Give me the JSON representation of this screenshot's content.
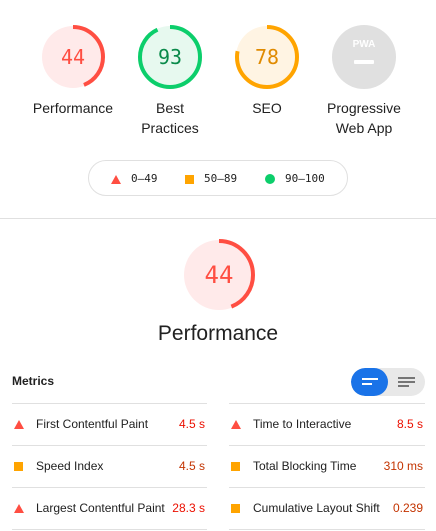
{
  "colors": {
    "fail": "#ff4e42",
    "average": "#ffa400",
    "pass": "#0cce6b",
    "fail_bg": "#ffeaea",
    "average_bg": "#fff4e3",
    "pass_bg": "#e7f9ef",
    "na_bg": "#e0e0e0"
  },
  "gauges": [
    {
      "score": "44",
      "label_line1": "Performance",
      "label_line2": ""
    },
    {
      "score": "93",
      "label_line1": "Best",
      "label_line2": "Practices"
    },
    {
      "score": "78",
      "label_line1": "SEO",
      "label_line2": ""
    },
    {
      "score": "PWA",
      "label_line1": "Progressive",
      "label_line2": "Web App"
    }
  ],
  "legend": {
    "fail": "0–49",
    "average": "50–89",
    "pass": "90–100"
  },
  "performance": {
    "score": "44",
    "title": "Performance"
  },
  "metrics": {
    "title": "Metrics",
    "left": [
      {
        "name": "First Contentful Paint",
        "value": "4.5 s",
        "rating": "fail"
      },
      {
        "name": "Speed Index",
        "value": "4.5 s",
        "rating": "average"
      },
      {
        "name": "Largest Contentful Paint",
        "value": "28.3 s",
        "rating": "fail"
      }
    ],
    "right": [
      {
        "name": "Time to Interactive",
        "value": "8.5 s",
        "rating": "fail"
      },
      {
        "name": "Total Blocking Time",
        "value": "310 ms",
        "rating": "average"
      },
      {
        "name": "Cumulative Layout Shift",
        "value": "0.239",
        "rating": "average"
      }
    ]
  }
}
